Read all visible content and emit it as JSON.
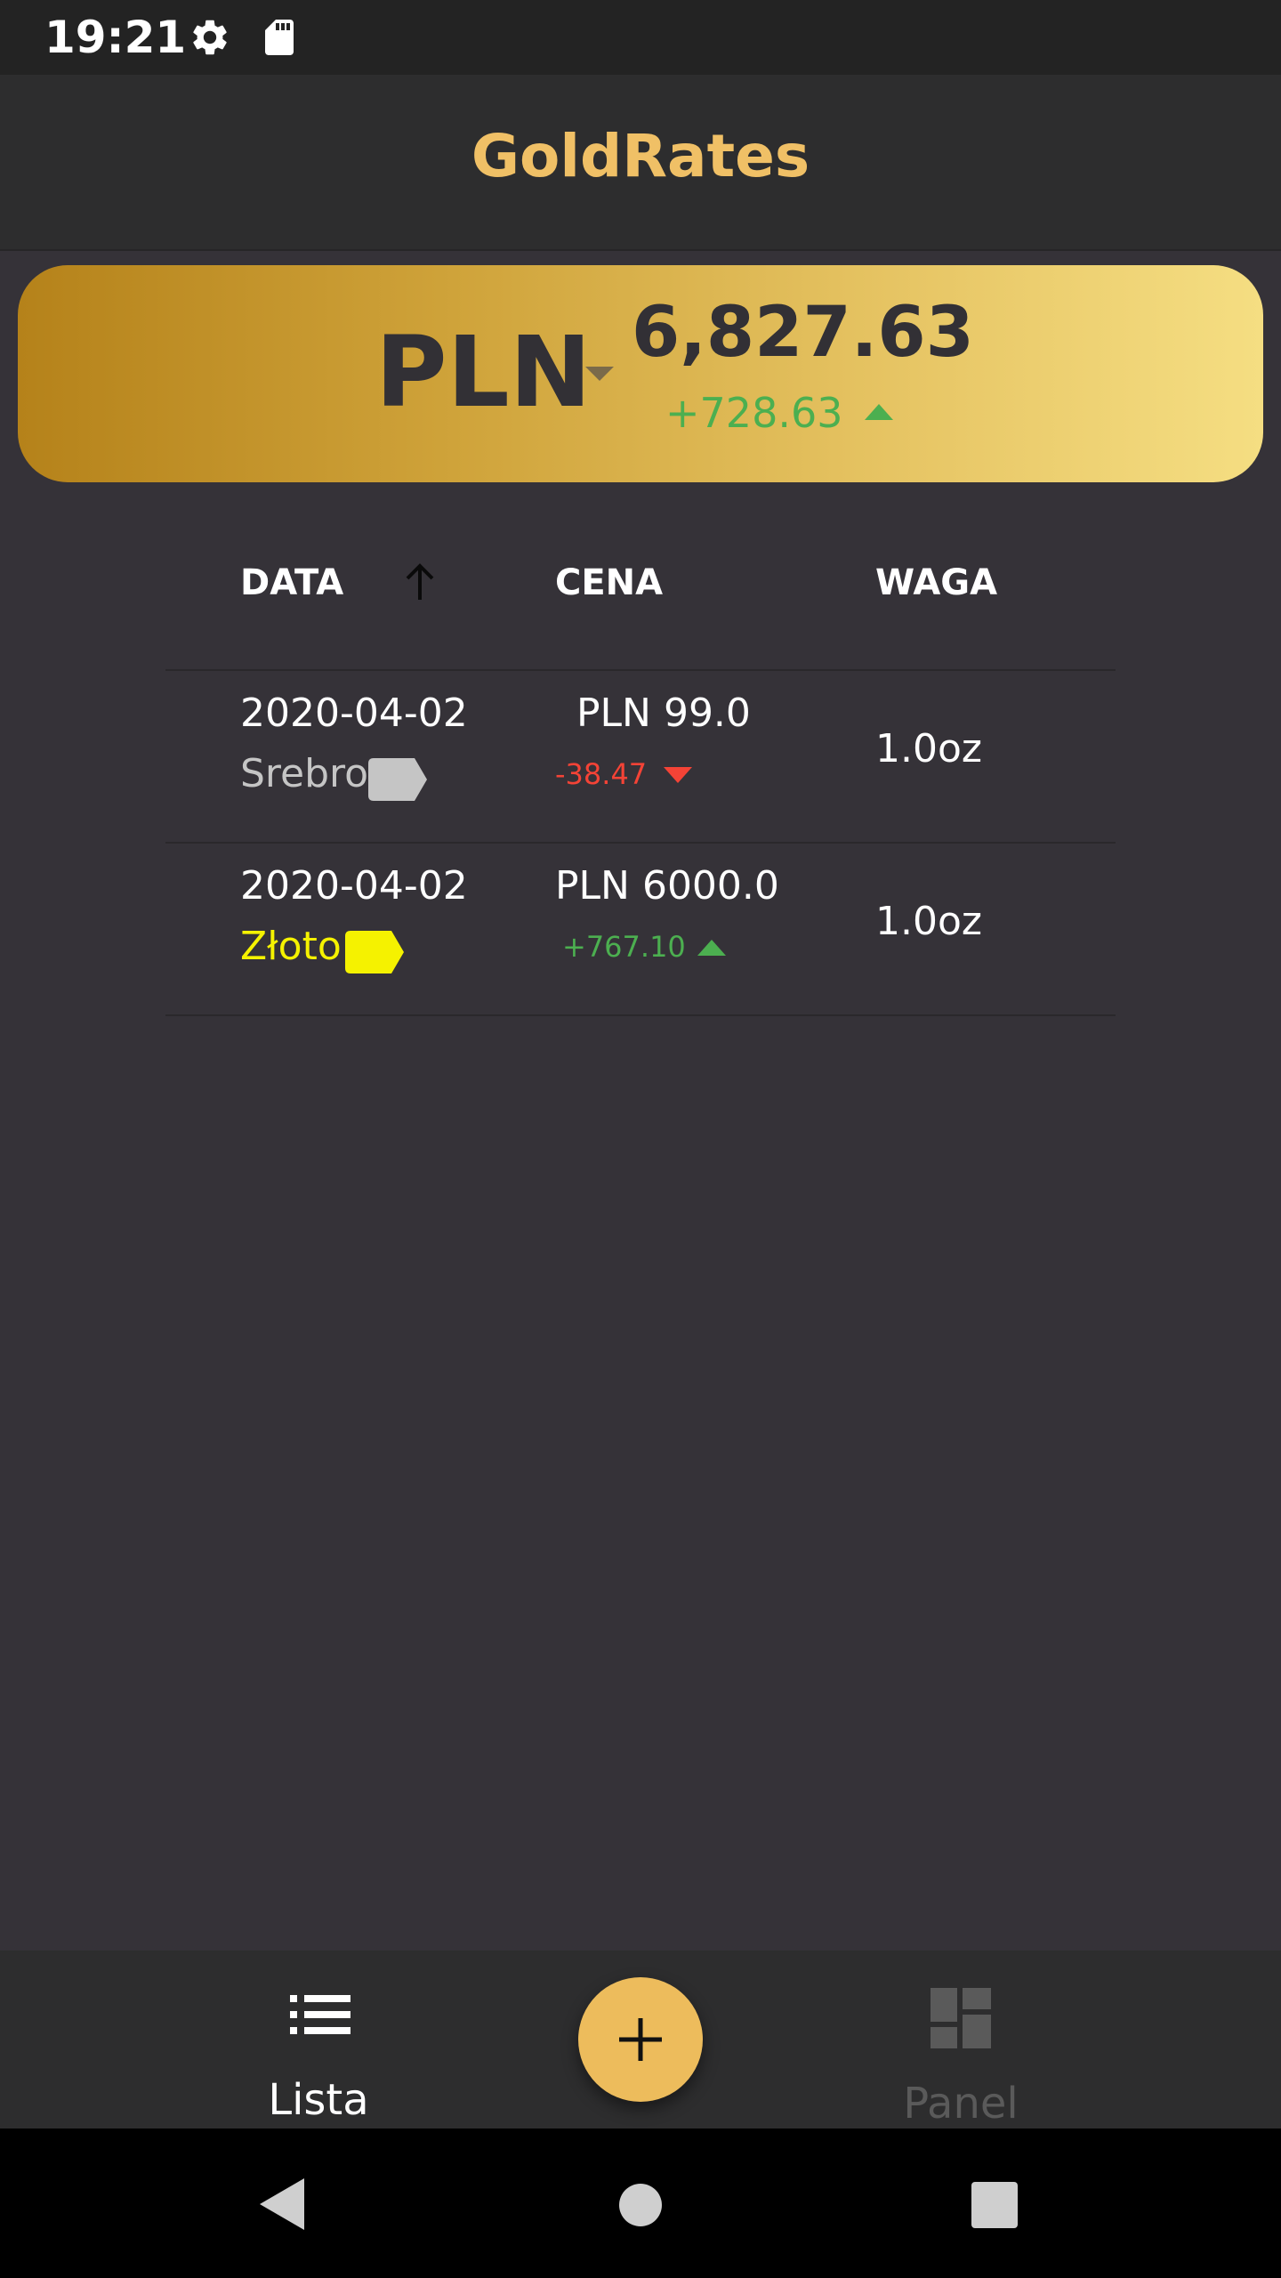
{
  "status_bar": {
    "time": "19:21",
    "icons": [
      "settings-icon",
      "sd-card-icon"
    ]
  },
  "app_bar": {
    "title": "GoldRates"
  },
  "summary": {
    "currency": "PLN",
    "total": "6,827.63",
    "change": "+728.63",
    "change_direction": "up"
  },
  "table": {
    "headers": {
      "date": "DATA",
      "price": "CENA",
      "weight": "WAGA"
    },
    "sort": {
      "column": "date",
      "direction": "ascending",
      "icon": "arrow-up-icon"
    },
    "rows": [
      {
        "date": "2020-04-02",
        "metal": "Srebro",
        "metal_color": "#c5c5c5",
        "price": "PLN 99.0",
        "diff": "-38.47",
        "diff_direction": "down",
        "weight": "1.0oz"
      },
      {
        "date": "2020-04-02",
        "metal": "Złoto",
        "metal_color": "#f5f200",
        "price": "PLN 6000.0",
        "diff": "+767.10",
        "diff_direction": "up",
        "weight": "1.0oz"
      }
    ]
  },
  "bottom_nav": {
    "items": [
      {
        "label": "Lista",
        "icon": "list-icon",
        "active": true
      },
      {
        "label": "Panel",
        "icon": "dashboard-icon",
        "active": false
      }
    ],
    "fab_icon": "plus-icon"
  },
  "colors": {
    "accent": "#edbc5c",
    "title": "#f0c066",
    "positive": "#4caf50",
    "negative": "#f44336",
    "background": "#353238",
    "inactive": "#5a5a5a"
  }
}
